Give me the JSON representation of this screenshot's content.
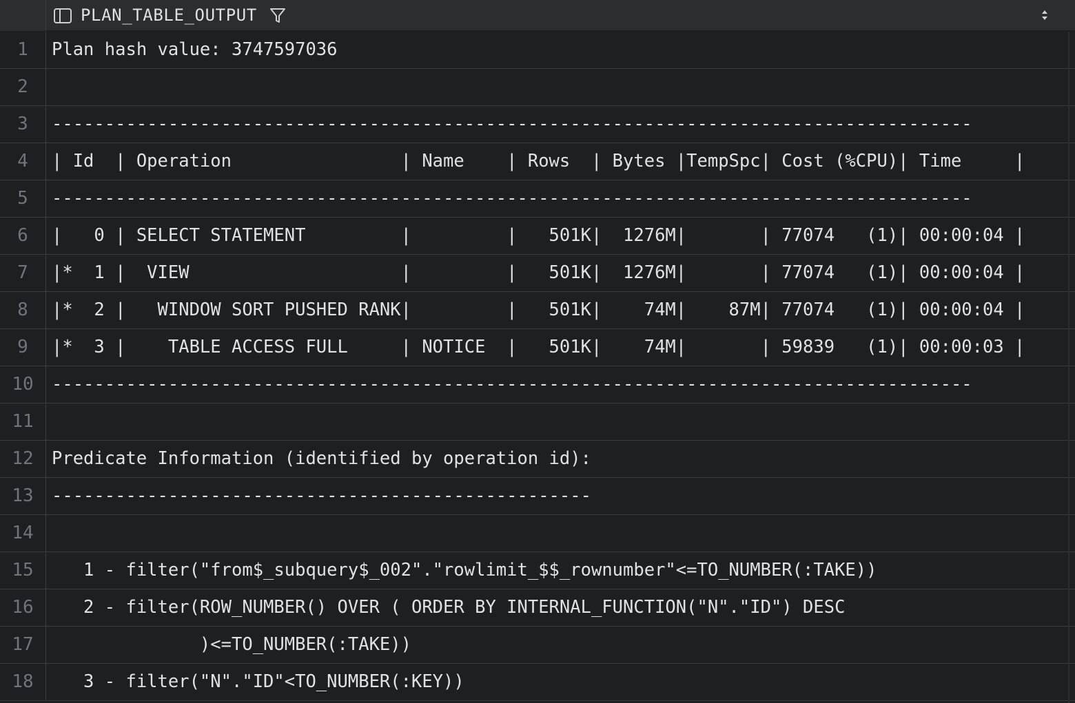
{
  "header": {
    "column_title": "PLAN_TABLE_OUTPUT"
  },
  "icons": {
    "column_type": "table-column-icon",
    "filter": "filter-icon",
    "sort": "sort-updown-icon"
  },
  "colors": {
    "background": "#1e1f22",
    "header_background": "#2b2d30",
    "text": "#dfe1e5",
    "line_number": "#6f737a",
    "gridline": "#3a3c40"
  },
  "rows": [
    {
      "num": "1",
      "text": "Plan hash value: 3747597036"
    },
    {
      "num": "2",
      "text": ""
    },
    {
      "num": "3",
      "text": "---------------------------------------------------------------------------------------"
    },
    {
      "num": "4",
      "text": "| Id  | Operation                | Name    | Rows  | Bytes |TempSpc| Cost (%CPU)| Time     |"
    },
    {
      "num": "5",
      "text": "---------------------------------------------------------------------------------------"
    },
    {
      "num": "6",
      "text": "|   0 | SELECT STATEMENT         |         |   501K|  1276M|       | 77074   (1)| 00:00:04 |"
    },
    {
      "num": "7",
      "text": "|*  1 |  VIEW                    |         |   501K|  1276M|       | 77074   (1)| 00:00:04 |"
    },
    {
      "num": "8",
      "text": "|*  2 |   WINDOW SORT PUSHED RANK|         |   501K|    74M|    87M| 77074   (1)| 00:00:04 |"
    },
    {
      "num": "9",
      "text": "|*  3 |    TABLE ACCESS FULL     | NOTICE  |   501K|    74M|       | 59839   (1)| 00:00:03 |"
    },
    {
      "num": "10",
      "text": "---------------------------------------------------------------------------------------"
    },
    {
      "num": "11",
      "text": ""
    },
    {
      "num": "12",
      "text": "Predicate Information (identified by operation id):"
    },
    {
      "num": "13",
      "text": "---------------------------------------------------"
    },
    {
      "num": "14",
      "text": ""
    },
    {
      "num": "15",
      "text": "   1 - filter(\"from$_subquery$_002\".\"rowlimit_$$_rownumber\"<=TO_NUMBER(:TAKE))"
    },
    {
      "num": "16",
      "text": "   2 - filter(ROW_NUMBER() OVER ( ORDER BY INTERNAL_FUNCTION(\"N\".\"ID\") DESC"
    },
    {
      "num": "17",
      "text": "              )<=TO_NUMBER(:TAKE))"
    },
    {
      "num": "18",
      "text": "   3 - filter(\"N\".\"ID\"<TO_NUMBER(:KEY))"
    }
  ]
}
